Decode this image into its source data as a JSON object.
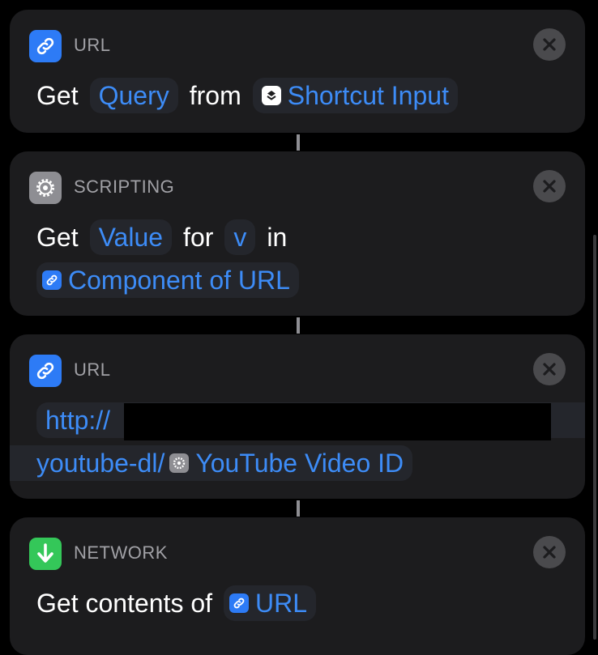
{
  "actions": [
    {
      "category": "URL",
      "icon": "link-icon",
      "line1": {
        "word1": "Get",
        "token1": "Query",
        "word2": "from",
        "token2": "Shortcut Input"
      }
    },
    {
      "category": "SCRIPTING",
      "icon": "gear-icon",
      "line1": {
        "word1": "Get",
        "token1": "Value",
        "word2": "for",
        "token2": "v",
        "word3": "in"
      },
      "line2": {
        "token1": "Component of URL"
      }
    },
    {
      "category": "URL",
      "icon": "link-icon",
      "line1": {
        "text": "http://"
      },
      "line2": {
        "text": "youtube-dl/",
        "token1": "YouTube Video ID"
      }
    },
    {
      "category": "NETWORK",
      "icon": "download-arrow-icon",
      "line1": {
        "word1": "Get contents of",
        "token1": "URL"
      }
    }
  ],
  "colors": {
    "accent": "#3d8cf7",
    "card": "#1c1c1e",
    "background": "#000000"
  }
}
